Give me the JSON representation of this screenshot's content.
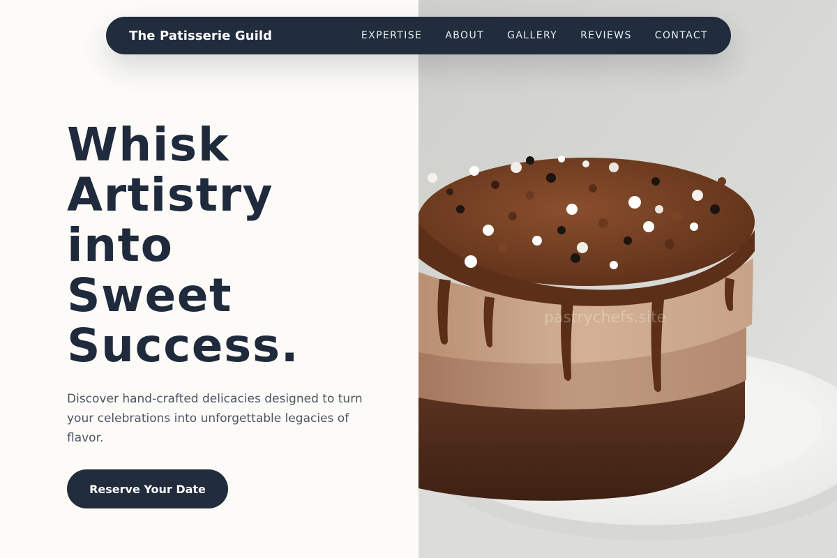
{
  "nav": {
    "brand": "The Patisserie Guild",
    "links": [
      {
        "label": "EXPERTISE"
      },
      {
        "label": "ABOUT"
      },
      {
        "label": "GALLERY"
      },
      {
        "label": "REVIEWS"
      },
      {
        "label": "CONTACT"
      }
    ]
  },
  "hero": {
    "headline_lines": [
      "Whisk",
      "Artistry",
      "into",
      "Sweet",
      "Success."
    ],
    "subtext": "Discover hand-crafted delicacies designed to turn your celebrations into unforgettable legacies of flavor.",
    "cta_label": "Reserve Your Date",
    "image_watermark": "pastrychefs.site"
  },
  "colors": {
    "navy": "#212c3d",
    "background": "#fcfbf8",
    "body_text": "#4d5563"
  }
}
